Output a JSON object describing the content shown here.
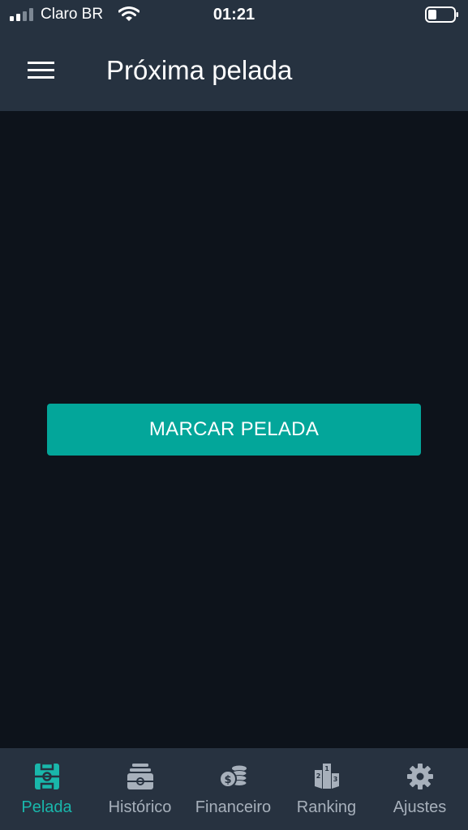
{
  "status_bar": {
    "carrier": "Claro BR",
    "time": "01:21",
    "signal_icon": "signal-bars-icon",
    "wifi_icon": "wifi-icon",
    "battery_icon": "battery-icon"
  },
  "header": {
    "menu_icon": "hamburger-menu-icon",
    "title": "Próxima pelada"
  },
  "main": {
    "primary_button_label": "MARCAR PELADA"
  },
  "tabbar": {
    "active": "Pelada",
    "items": [
      {
        "label": "Pelada",
        "icon": "soccer-field-icon"
      },
      {
        "label": "Histórico",
        "icon": "history-box-icon"
      },
      {
        "label": "Financeiro",
        "icon": "coins-icon"
      },
      {
        "label": "Ranking",
        "icon": "podium-icon"
      },
      {
        "label": "Ajustes",
        "icon": "gear-icon"
      }
    ]
  },
  "colors": {
    "header_bg": "#263240",
    "page_bg": "#0d131b",
    "accent": "#03a69a",
    "tab_inactive": "#a7b0bb"
  }
}
